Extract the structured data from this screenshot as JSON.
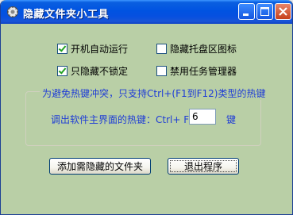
{
  "window": {
    "title": "隐藏文件夹小工具",
    "accent": "#0053e1",
    "background": "#b9cfa6",
    "app_icon": "gear-icon"
  },
  "options": [
    {
      "label": "开机自动运行",
      "checked": true
    },
    {
      "label": "隐藏托盘区图标",
      "checked": false
    },
    {
      "label": "只隐藏不锁定",
      "checked": true
    },
    {
      "label": "禁用任务管理器",
      "checked": false
    }
  ],
  "hotkey": {
    "caption": "为避免热键冲突，只支持Ctrl+(F1到F12)类型的热键",
    "label": "调出软件主界面的热键：Ctrl+  F",
    "value": "6",
    "suffix": "键",
    "text_color": "#1f3dd6"
  },
  "buttons": {
    "add": "添加需隐藏的文件夹",
    "exit": "退出程序"
  }
}
